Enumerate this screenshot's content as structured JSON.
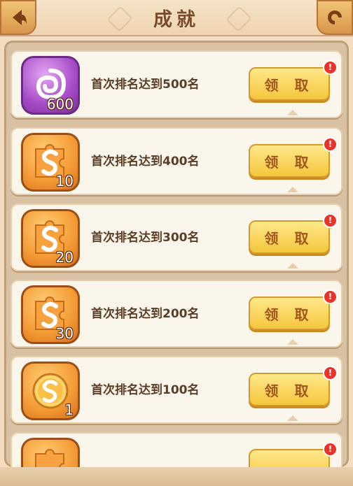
{
  "header": {
    "title": "成就",
    "back_icon": "back-arrow-icon",
    "menu_icon": "swirl-icon"
  },
  "achievements": [
    {
      "description": "首次排名达到500名",
      "reward_icon": "purple-swirl-icon",
      "quantity": "600",
      "claim_label": "领 取"
    },
    {
      "description": "首次排名达到400名",
      "reward_icon": "puzzle-s-icon",
      "quantity": "10",
      "claim_label": "领 取"
    },
    {
      "description": "首次排名达到300名",
      "reward_icon": "puzzle-s-icon",
      "quantity": "20",
      "claim_label": "领 取"
    },
    {
      "description": "首次排名达到200名",
      "reward_icon": "puzzle-s-icon",
      "quantity": "30",
      "claim_label": "领 取"
    },
    {
      "description": "首次排名达到100名",
      "reward_icon": "coin-s-icon",
      "quantity": "1",
      "claim_label": "领 取"
    }
  ],
  "alert_mark": "!",
  "colors": {
    "accent": "#f4c63c",
    "title": "#7a4a2a",
    "alert": "#e8322a"
  }
}
